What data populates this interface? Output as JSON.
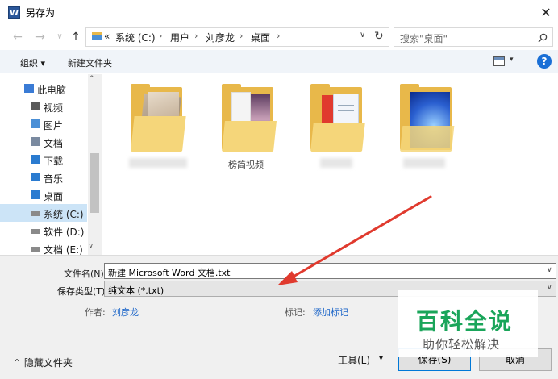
{
  "window": {
    "title": "另存为",
    "app_icon_letter": "W",
    "close_glyph": "✕"
  },
  "address": {
    "back_glyph": "←",
    "forward_glyph": "→",
    "recent_glyph": "∨",
    "up_glyph": "↑",
    "overflow": "«",
    "crumbs": [
      "系统 (C:)",
      "用户",
      "刘彦龙",
      "桌面"
    ],
    "separator": "›",
    "dropdown_glyph": "∨",
    "refresh_glyph": "↻"
  },
  "search": {
    "placeholder": "搜索\"桌面\"",
    "icon": "search-icon"
  },
  "toolbar": {
    "organize": "组织 ▾",
    "new_folder": "新建文件夹",
    "view_caret": "▾",
    "help": "?"
  },
  "sidebar": {
    "items": [
      {
        "label": "此电脑",
        "icon": "computer-icon",
        "selected": false
      },
      {
        "label": "视频",
        "icon": "video-icon",
        "selected": false
      },
      {
        "label": "图片",
        "icon": "picture-icon",
        "selected": false
      },
      {
        "label": "文档",
        "icon": "document-icon",
        "selected": false
      },
      {
        "label": "下载",
        "icon": "download-icon",
        "selected": false
      },
      {
        "label": "音乐",
        "icon": "music-icon",
        "selected": false
      },
      {
        "label": "桌面",
        "icon": "desktop-icon",
        "selected": false
      },
      {
        "label": "系统 (C:)",
        "icon": "drive-icon",
        "selected": true
      },
      {
        "label": "软件 (D:)",
        "icon": "drive-icon",
        "selected": false
      },
      {
        "label": "文档 (E:)",
        "icon": "drive-icon",
        "selected": false
      }
    ],
    "scroll_up": "^",
    "scroll_down": "v"
  },
  "files": [
    {
      "name": "",
      "icon": "folder-icon"
    },
    {
      "name": "榜简视频",
      "icon": "folder-icon"
    },
    {
      "name": "",
      "icon": "folder-icon"
    },
    {
      "name": "",
      "icon": "folder-icon"
    }
  ],
  "form": {
    "filename_label": "文件名(N):",
    "filename_value": "新建 Microsoft Word 文档.txt",
    "filetype_label": "保存类型(T):",
    "filetype_value": "纯文本 (*.txt)",
    "author_label": "作者:",
    "author_value": "刘彦龙",
    "tags_label": "标记:",
    "tags_value": "添加标记"
  },
  "footer": {
    "hide_folders": "⌃ 隐藏文件夹",
    "tools": "工具(L)",
    "tools_caret": "▾",
    "save": "保存(S)",
    "cancel": "取消"
  },
  "watermark": {
    "title": "百科全说",
    "subtitle": "助你轻松解决"
  },
  "colors": {
    "accent": "#0078d7",
    "selection": "#cce4f7",
    "toolbar_bg": "#f0f4f9",
    "arrow": "#e03a2e",
    "watermark_green": "#1aa55a"
  }
}
